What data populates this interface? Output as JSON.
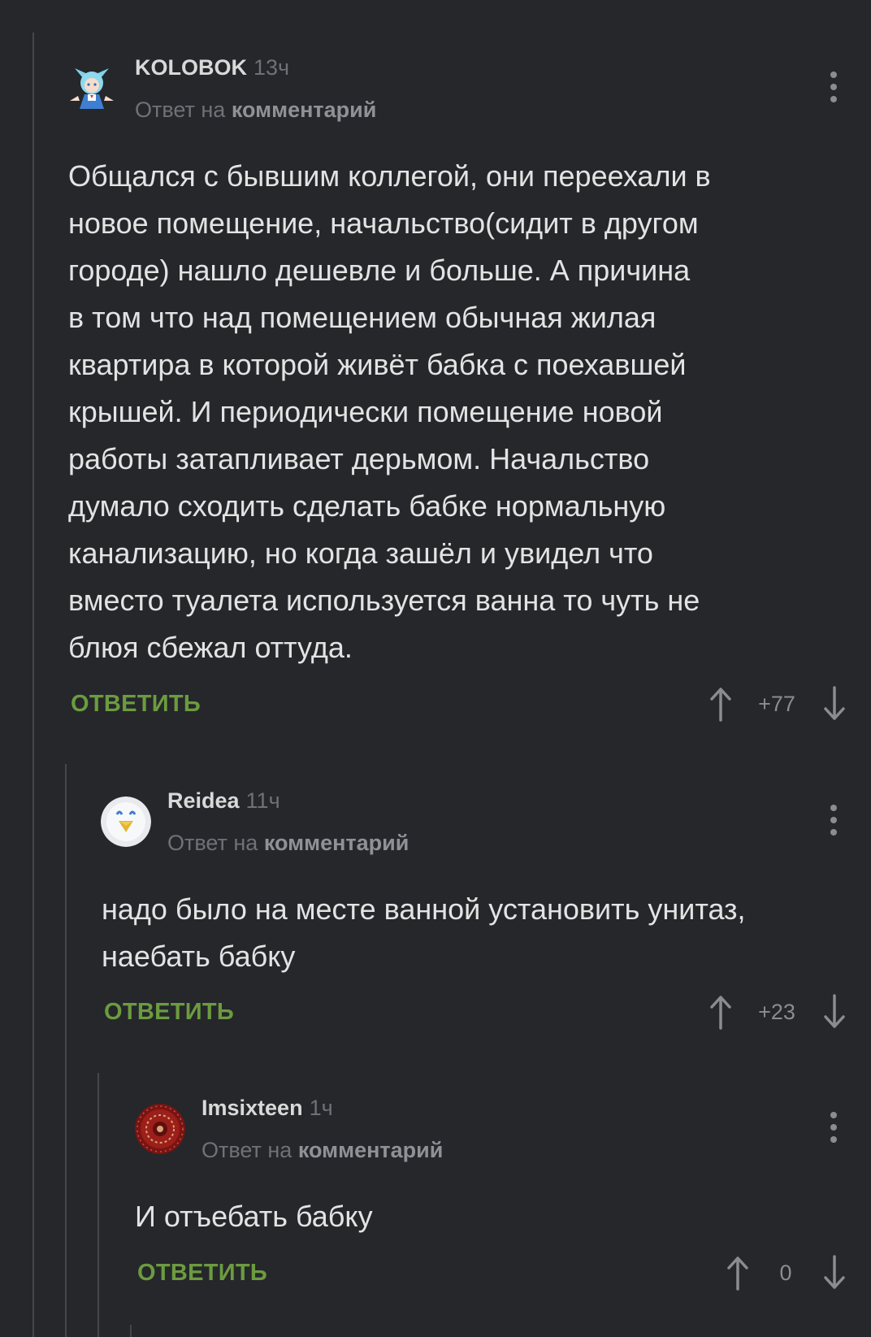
{
  "comments": [
    {
      "author": "KOLOBOK",
      "time": "13ч",
      "reply_prefix": "Ответ на",
      "reply_link": "комментарий",
      "body": "Общался с бывшим коллегой, они переехали в\nновое помещение, начальство(сидит в другом\nгороде) нашло дешевле и больше. А причина\nв том что над помещением обычная жилая\nквартира в которой живёт бабка с поехавшей\nкрышей. И периодически помещение новой\nработы затапливает дерьмом. Начальство\nдумало сходить сделать бабке нормальную\nканализацию, но когда зашёл и увидел что\nвместо туалета используется ванна то чуть не\nблюя сбежал оттуда.",
      "reply_label": "ОТВЕТИТЬ",
      "rating": "+77",
      "avatar_icon": "anime-girl-avatar"
    },
    {
      "author": "Reidea",
      "time": "11ч",
      "reply_prefix": "Ответ на",
      "reply_link": "комментарий",
      "body": "надо было на месте ванной установить унитаз,\nнаебать бабку",
      "reply_label": "ОТВЕТИТЬ",
      "rating": "+23",
      "avatar_icon": "bird-avatar"
    },
    {
      "author": "Imsixteen",
      "time": "1ч",
      "reply_prefix": "Ответ на",
      "reply_link": "комментарий",
      "body": "И отъебать бабку",
      "reply_label": "ОТВЕТИТЬ",
      "rating": "0",
      "avatar_icon": "red-carpet-avatar"
    }
  ],
  "colors": {
    "background": "#25272b",
    "accent_reply": "#6c9b3f",
    "thread_line": "#44464b",
    "muted_text": "#6f7176"
  }
}
